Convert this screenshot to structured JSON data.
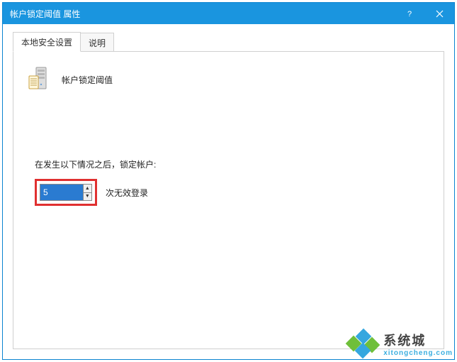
{
  "window": {
    "title": "帐户锁定阈值 属性"
  },
  "tabs": {
    "local": "本地安全设置",
    "explain": "说明"
  },
  "policy": {
    "title": "帐户锁定阈值"
  },
  "lockout": {
    "label": "在发生以下情况之后，锁定帐户:",
    "value": "5",
    "suffix": "次无效登录"
  },
  "watermark": {
    "line1": "系统城",
    "line2": "xitongcheng.com",
    "colors": {
      "blue": "#35a7df",
      "green": "#6fbf3a"
    }
  }
}
